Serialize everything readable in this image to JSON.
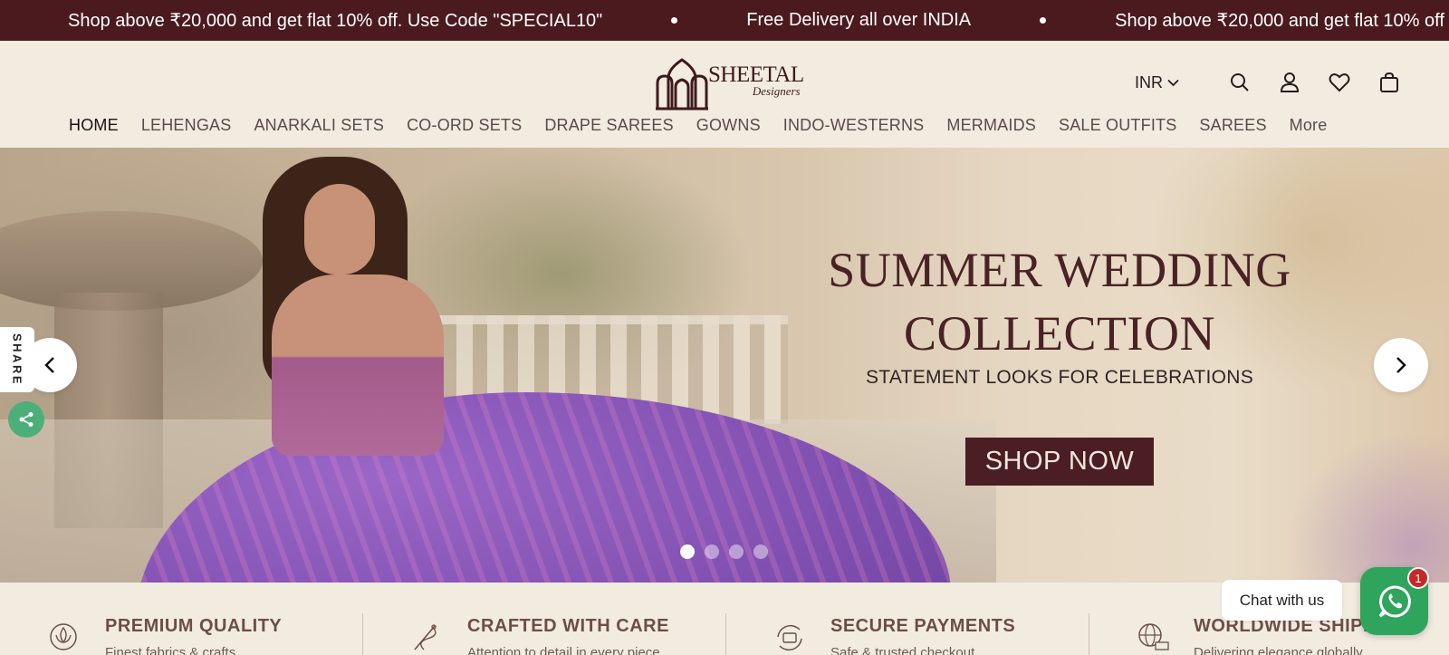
{
  "announcement": {
    "messages": [
      "Shop above ₹20,000 and get flat 10% off. Use Code \"SPECIAL10\"",
      "Free Delivery all over INDIA",
      "Shop above ₹20,000 and get flat 10% off"
    ]
  },
  "header": {
    "logo": {
      "brand": "SHEETAL",
      "sub": "Designers"
    },
    "currency": "INR",
    "icons": [
      "search-icon",
      "account-icon",
      "wishlist-icon",
      "cart-icon"
    ]
  },
  "nav": {
    "items": [
      "HOME",
      "LEHENGAS",
      "ANARKALI SETS",
      "CO-ORD SETS",
      "DRAPE SAREES",
      "GOWNS",
      "INDO-WESTERNS",
      "MERMAIDS",
      "SALE OUTFITS",
      "SAREES",
      "More"
    ]
  },
  "hero": {
    "title_line1": "SUMMER WEDDING",
    "title_line2": "COLLECTION",
    "subtitle": "STATEMENT LOOKS FOR CELEBRATIONS",
    "cta": "SHOP NOW",
    "slide_count": 4,
    "active_slide": 1
  },
  "share": {
    "label": "SHARE"
  },
  "features": [
    {
      "title": "PREMIUM QUALITY",
      "desc": "Finest fabrics & crafts",
      "icon": "lotus-badge-icon"
    },
    {
      "title": "CRAFTED WITH CARE",
      "desc": "Attention to detail in every piece",
      "icon": "needle-thread-icon"
    },
    {
      "title": "SECURE PAYMENTS",
      "desc": "Safe & trusted checkout",
      "icon": "secure-payment-icon"
    },
    {
      "title": "WORLDWIDE SHIPPING",
      "desc": "Delivering elegance globally",
      "icon": "globe-truck-icon"
    }
  ],
  "chat": {
    "label": "Chat with us",
    "badge": "1"
  },
  "colors": {
    "accent": "#4a1a1f",
    "background": "#f2ebe0",
    "whatsapp": "#2fa45c",
    "badge": "#c62828"
  }
}
